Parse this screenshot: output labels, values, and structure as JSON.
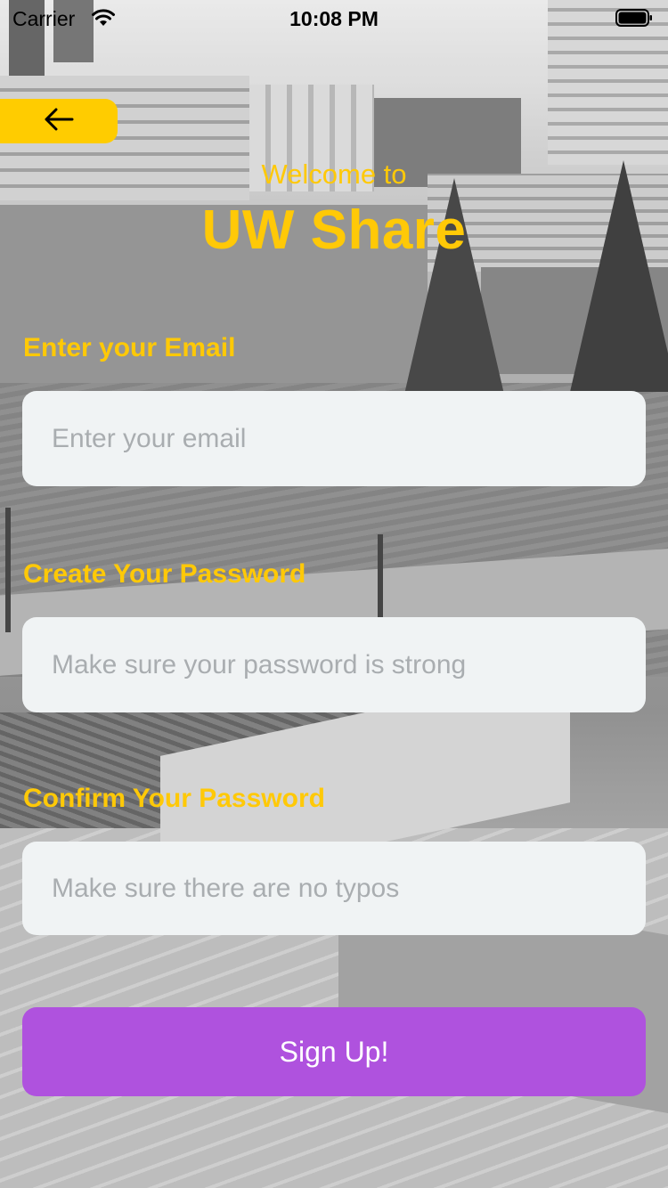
{
  "status_bar": {
    "carrier": "Carrier",
    "time": "10:08 PM",
    "icons": [
      "wifi-icon",
      "battery-icon"
    ]
  },
  "header": {
    "back_icon": "arrow-left-icon",
    "welcome_text": "Welcome to",
    "app_title": "UW Share"
  },
  "form": {
    "email": {
      "label": "Enter your Email",
      "placeholder": "Enter your email",
      "value": ""
    },
    "password": {
      "label": "Create Your Password",
      "placeholder": "Make sure your password is strong",
      "value": ""
    },
    "confirm_password": {
      "label": "Confirm Your Password",
      "placeholder": "Make sure there are no typos",
      "value": ""
    },
    "submit_label": "Sign Up!"
  },
  "colors": {
    "accent_yellow": "#ffc907",
    "button_purple": "#af52de",
    "field_background": "#f0f3f4"
  }
}
